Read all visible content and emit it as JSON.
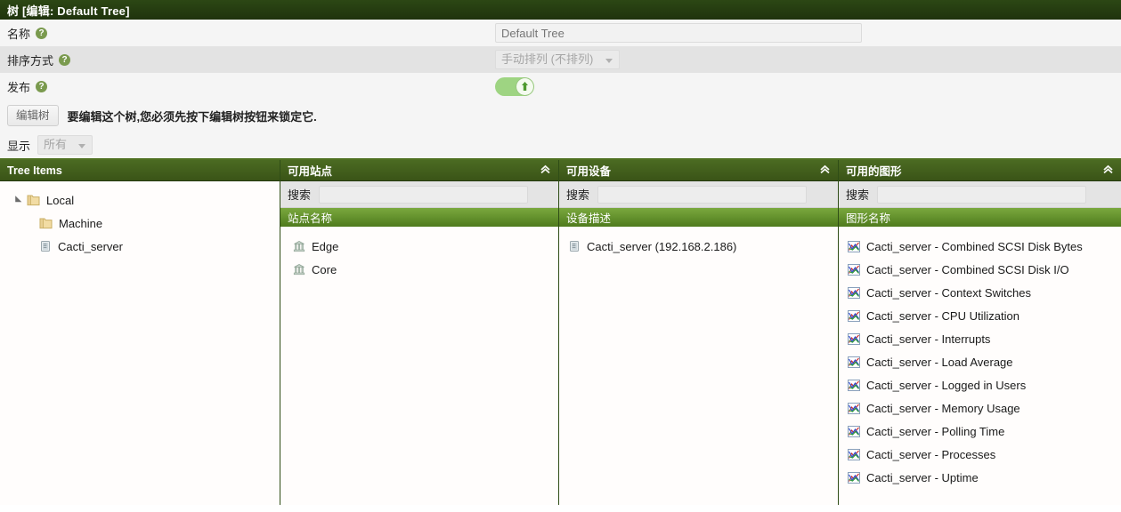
{
  "window": {
    "title": "树 [编辑: Default Tree]"
  },
  "form": {
    "name_label": "名称",
    "name_value": "Default Tree",
    "name_placeholder": "Default Tree",
    "sort_label": "排序方式",
    "sort_value": "手动排列 (不排列)",
    "publish_label": "发布",
    "publish_state": "on",
    "help_glyph": "?"
  },
  "actions": {
    "edit_tree_button": "编辑树",
    "note": "要编辑这个树,您必须先按下编辑树按钮来锁定它."
  },
  "filter": {
    "label": "显示",
    "value": "所有"
  },
  "panels": {
    "tree": {
      "title": "Tree Items",
      "items": [
        {
          "label": "Local",
          "icon": "folder-icon",
          "level": 0,
          "expander": true
        },
        {
          "label": "Machine",
          "icon": "folder-icon",
          "level": 1,
          "expander": false
        },
        {
          "label": "Cacti_server",
          "icon": "device-icon",
          "level": 1,
          "expander": false
        }
      ]
    },
    "sites": {
      "title": "可用站点",
      "search_label": "搜索",
      "column_header": "站点名称",
      "items": [
        {
          "label": "Edge",
          "icon": "site-icon"
        },
        {
          "label": "Core",
          "icon": "site-icon"
        }
      ]
    },
    "devices": {
      "title": "可用设备",
      "search_label": "搜索",
      "column_header": "设备描述",
      "items": [
        {
          "label": "Cacti_server (192.168.2.186)",
          "icon": "device-icon"
        }
      ]
    },
    "graphs": {
      "title": "可用的图形",
      "search_label": "搜索",
      "column_header": "图形名称",
      "items": [
        {
          "label": "Cacti_server - Combined SCSI Disk Bytes",
          "icon": "graph-icon"
        },
        {
          "label": "Cacti_server - Combined SCSI Disk I/O",
          "icon": "graph-icon"
        },
        {
          "label": "Cacti_server - Context Switches",
          "icon": "graph-icon"
        },
        {
          "label": "Cacti_server - CPU Utilization",
          "icon": "graph-icon"
        },
        {
          "label": "Cacti_server - Interrupts",
          "icon": "graph-icon"
        },
        {
          "label": "Cacti_server - Load Average",
          "icon": "graph-icon"
        },
        {
          "label": "Cacti_server - Logged in Users",
          "icon": "graph-icon"
        },
        {
          "label": "Cacti_server - Memory Usage",
          "icon": "graph-icon"
        },
        {
          "label": "Cacti_server - Polling Time",
          "icon": "graph-icon"
        },
        {
          "label": "Cacti_server - Processes",
          "icon": "graph-icon"
        },
        {
          "label": "Cacti_server - Uptime",
          "icon": "graph-icon"
        }
      ]
    }
  },
  "colors": {
    "titlebar": "#23390f",
    "panel_header": "#3f5a19",
    "column_header": "#66972e",
    "toggle_on": "#9ed482",
    "help_icon": "#7a9a4e"
  }
}
